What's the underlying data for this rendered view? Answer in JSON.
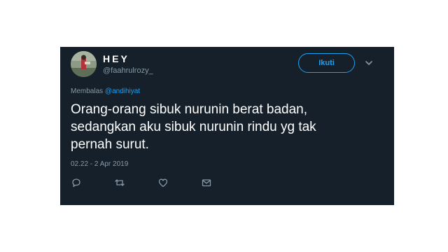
{
  "tweet": {
    "display_name": "HEY",
    "username": "@faahrulrozy_",
    "follow_label": "Ikuti",
    "reply_prefix": "Membalas",
    "reply_mention": "@andihiyat",
    "text_lines": [
      "Orang-orang sibuk nurunin berat badan,",
      "sedangkan aku sibuk nurunin rindu yg tak",
      "pernah surut."
    ],
    "timestamp": "02.22 - 2 Apr 2019"
  },
  "colors": {
    "card_background": "#15202b",
    "accent": "#1da1f2",
    "secondary_text": "#8899a6",
    "primary_text": "#ffffff"
  },
  "icons": {
    "menu": "chevron-down-icon",
    "reply": "reply-icon",
    "retweet": "retweet-icon",
    "like": "heart-icon",
    "message": "envelope-icon"
  }
}
